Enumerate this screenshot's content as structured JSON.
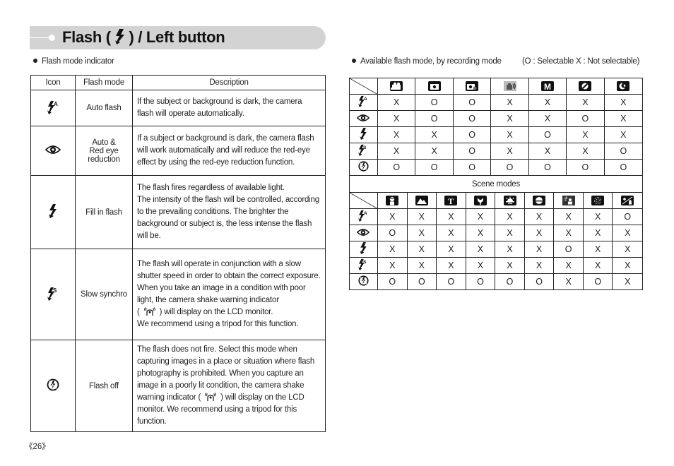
{
  "header": {
    "title_before": "Flash (",
    "title_icon": "flash-icon",
    "title_after": ") / Left button"
  },
  "left_section": {
    "bullet": "Flash mode indicator",
    "columns": [
      "Icon",
      "Flash mode",
      "Description"
    ],
    "rows": [
      {
        "icon": "auto-flash-icon",
        "mode": "Auto flash",
        "description": [
          "If the subject or background is dark, the camera",
          "flash will operate automatically."
        ]
      },
      {
        "icon": "red-eye-icon",
        "mode": [
          "Auto &",
          "Red eye",
          "reduction"
        ],
        "description": [
          "If a subject or background is dark, the camera flash",
          "will work automatically and will reduce the red-eye",
          "effect by using the red-eye reduction function."
        ]
      },
      {
        "icon": "fill-flash-icon",
        "mode": "Fill in flash",
        "description": [
          "The flash fires regardless of available light.",
          "The intensity of the flash will be controlled, according",
          "to the prevailing conditions. The brighter the",
          "background or subject is, the less intense the flash",
          "will be."
        ]
      },
      {
        "icon": "slow-synchro-icon",
        "mode": "Slow synchro",
        "description": [
          "The flash will operate in conjunction with a slow",
          "shutter speed in order to obtain the correct exposure.",
          "When you take an image in a condition with poor",
          "light, the camera shake warning indicator",
          "( [shake-warning-icon] ) will display on the LCD monitor.",
          "We recommend using a tripod for this function."
        ]
      },
      {
        "icon": "flash-off-icon",
        "mode": "Flash off",
        "description": [
          "The flash does not fire. Select this mode when",
          "capturing images in a place or situation where flash",
          "photography is prohibited. When you capture an",
          "image in a poorly lit condition, the camera shake",
          "warning indicator ( [shake-warning-icon] ) will display on the LCD",
          "monitor. We recommend using a tripod for this",
          "function."
        ]
      }
    ]
  },
  "right_section": {
    "bullet": "Available flash mode, by recording mode",
    "legend": "(O : Selectable X : Not selectable)",
    "flash_modes": [
      "auto-flash-icon",
      "red-eye-icon",
      "fill-flash-icon",
      "slow-synchro-icon",
      "flash-off-icon"
    ],
    "recording_modes": {
      "columns": [
        "movie-icon",
        "auto-camera-icon",
        "program-icon",
        "dis-icon",
        "manual-icon",
        "portrait-mode-icon",
        "night-icon"
      ],
      "values": [
        [
          "X",
          "O",
          "O",
          "X",
          "X",
          "X",
          "X"
        ],
        [
          "X",
          "O",
          "O",
          "X",
          "X",
          "O",
          "X"
        ],
        [
          "X",
          "X",
          "O",
          "X",
          "O",
          "X",
          "X"
        ],
        [
          "X",
          "X",
          "O",
          "X",
          "X",
          "X",
          "O"
        ],
        [
          "O",
          "O",
          "O",
          "O",
          "O",
          "O",
          "O"
        ]
      ]
    },
    "scene_label": "Scene modes",
    "scene_modes": {
      "columns": [
        "portrait-icon",
        "landscape-icon",
        "text-icon",
        "close-up-icon",
        "sunset-icon",
        "dawn-icon",
        "backlight-icon",
        "fireworks-icon",
        "beach-snow-icon"
      ],
      "values": [
        [
          "X",
          "X",
          "X",
          "X",
          "X",
          "X",
          "X",
          "X",
          "O"
        ],
        [
          "O",
          "X",
          "X",
          "X",
          "X",
          "X",
          "X",
          "X",
          "X"
        ],
        [
          "X",
          "X",
          "X",
          "X",
          "X",
          "X",
          "O",
          "X",
          "X"
        ],
        [
          "X",
          "X",
          "X",
          "X",
          "X",
          "X",
          "X",
          "X",
          "X"
        ],
        [
          "O",
          "O",
          "O",
          "O",
          "O",
          "O",
          "X",
          "O",
          "X"
        ]
      ]
    }
  },
  "footer": {
    "page_number": "《26》"
  }
}
